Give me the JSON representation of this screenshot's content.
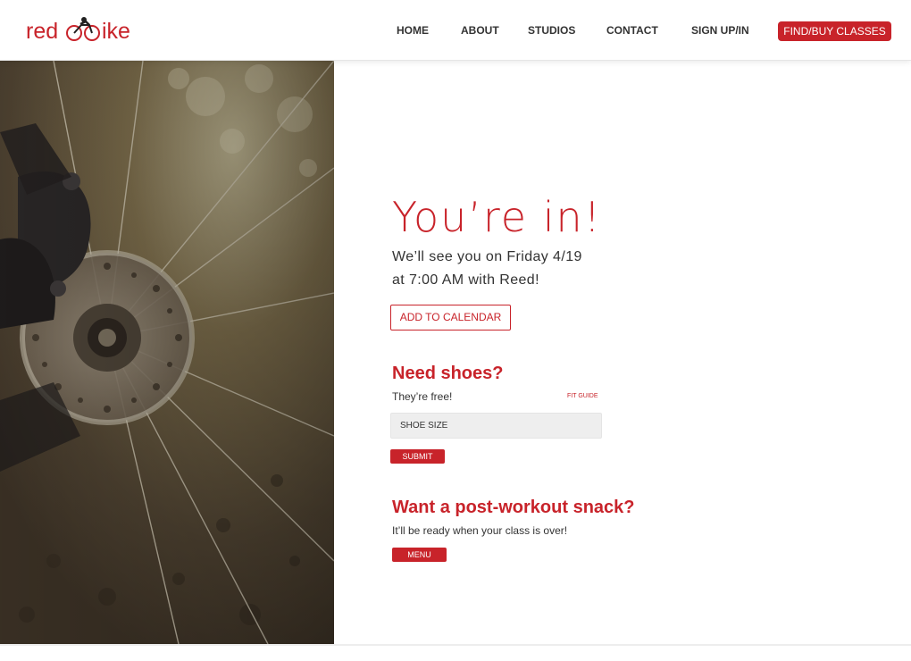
{
  "brand": {
    "logo_text": "redbike",
    "accent_color": "#c8232a"
  },
  "nav": {
    "items": [
      "HOME",
      "ABOUT",
      "STUDIOS",
      "CONTACT",
      "SIGN UP/IN"
    ],
    "cta_label": "FIND/BUY CLASSES"
  },
  "confirmation": {
    "title": "You’re in!",
    "line1": "We’ll see you on Friday 4/19",
    "line2": "at 7:00 AM with Reed!",
    "add_to_calendar_label": "ADD TO CALENDAR"
  },
  "shoes": {
    "heading": "Need shoes?",
    "subtext": "They’re free!",
    "fit_guide_label": "FIT GUIDE",
    "size_placeholder": "SHOE SIZE",
    "submit_label": "SUBMIT"
  },
  "snack": {
    "heading": "Want a post-workout snack?",
    "subtext": "It’ll be ready when your class is over!",
    "menu_label": "MENU"
  },
  "hero_image": {
    "subject": "bicycle-disc-brake-photo"
  }
}
